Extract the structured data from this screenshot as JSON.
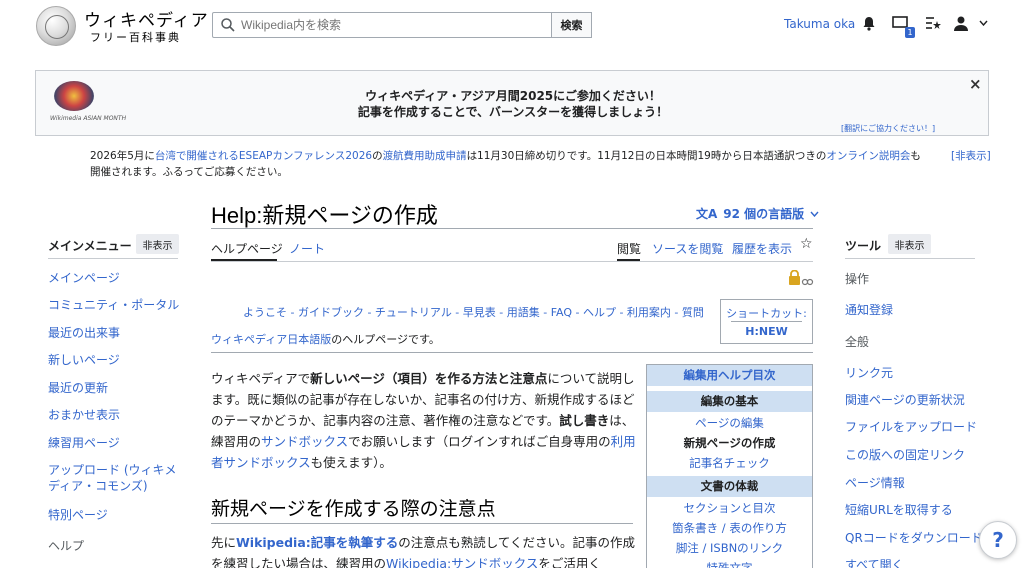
{
  "header": {
    "logo_title": "ウィキペディア",
    "logo_subtitle": "フリー百科事典",
    "search_placeholder": "Wikipedia内を検索",
    "search_button": "検索",
    "user_name": "Takuma oka",
    "notification_count": "1"
  },
  "banner": {
    "logo_caption": "Wikimedia ASIAN MONTH",
    "line1": "ウィキペディア・アジア月間2025にご参加ください！",
    "line2": "記事を作成することで、バーンスターを獲得しましょう！",
    "close": "×",
    "translate": "[翻訳にご協力ください！]"
  },
  "sitenotice": {
    "t1": "2026年5月に",
    "l1": "台湾で開催されるESEAPカンファレンス2026",
    "t2": "の",
    "l2": "渡航費用助成申請",
    "t3": "は11月30日締め切りです。11月12日の日本時間19時から日本語通訳つきの",
    "l3": "オンライン説明会",
    "t4": "も開催されます。ふるってご応募ください。",
    "hide": "[非表示]"
  },
  "page": {
    "title": "Help:新規ページの作成",
    "languages": "92 個の言語版"
  },
  "tabs": {
    "help": "ヘルプページ",
    "note": "ノート",
    "read": "閲覧",
    "source": "ソースを閲覧",
    "history": "履歴を表示",
    "star": "☆"
  },
  "sidebar": {
    "heading": "メインメニュー",
    "hide": "非表示",
    "items": [
      "メインページ",
      "コミュニティ・ポータル",
      "最近の出来事",
      "新しいページ",
      "最近の更新",
      "おまかせ表示",
      "練習用ページ",
      "アップロード (ウィキメディア・コモンズ)",
      "特別ページ"
    ],
    "section_help": "ヘルプ"
  },
  "tools": {
    "heading": "ツール",
    "hide": "非表示",
    "section_ops": "操作",
    "watch": "通知登録",
    "section_general": "全般",
    "items": [
      "リンク元",
      "関連ページの更新状況",
      "ファイルをアップロード",
      "この版への固定リンク",
      "ページ情報",
      "短縮URLを取得する",
      "QRコードをダウンロード",
      "すべて開く"
    ]
  },
  "content": {
    "nav_links": "ようこそ - ガイドブック - チュートリアル - 早見表 - 用語集 - FAQ - ヘルプ - 利用案内 - 質問",
    "shortcut_label": "ショートカット:",
    "shortcut_value": "H:NEW",
    "intro_link": "ウィキペディア日本語版",
    "intro_rest": "のヘルプページです。",
    "p1_a": "ウィキペディアで",
    "p1_b": "新しいページ（項目）を作る方法と注意点",
    "p1_c": "について説明します。既に類似の記事が存在しないか、記事名の付け方、新規作成するほどのテーマかどうか、記事内容の注意、著作権の注意などです。",
    "p1_d": "試し書き",
    "p1_e": "は、練習用の",
    "p1_f": "サンドボックス",
    "p1_g": "でお願いします（ログインすればご自身専用の",
    "p1_h": "利用者サンドボックス",
    "p1_i": "も使えます）。",
    "h2": "新規ページを作成する際の注意点",
    "p2_a": "先に",
    "p2_b": "Wikipedia:記事を執筆する",
    "p2_c": "の注意点も熟読してください。記事の作成を練習したい場合は、練習用の",
    "p2_d": "Wikipedia:サンドボックス",
    "p2_e": "をご活用く"
  },
  "toc": {
    "title": "編集用ヘルプ目次",
    "section1": "編集の基本",
    "s1_items": [
      "ページの編集",
      "新規ページの作成",
      "記事名チェック"
    ],
    "section2": "文書の体裁",
    "s2_items": [
      "セクションと目次",
      "箇条書き / 表の作り方",
      "脚注 / ISBNのリンク",
      "特殊文字"
    ]
  },
  "help_fab": "?",
  "colors": {
    "link": "#3366cc",
    "toc_header": "#cedff2",
    "border": "#a2a9b1"
  }
}
